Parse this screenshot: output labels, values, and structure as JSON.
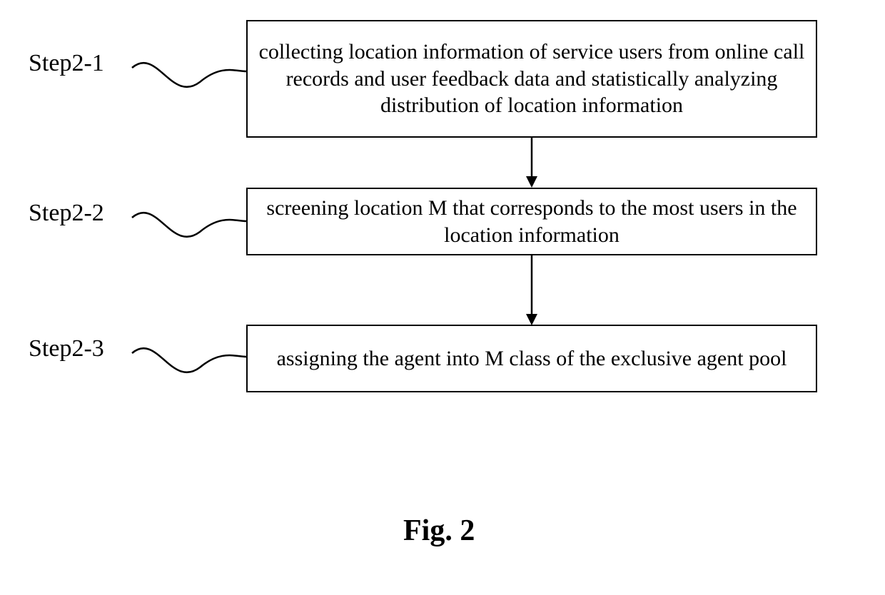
{
  "steps": [
    {
      "label": "Step2-1",
      "text": "collecting location information of service users from online call records and user feedback data and statistically analyzing distribution of location information"
    },
    {
      "label": "Step2-2",
      "text": "screening location M that corresponds to the most users in the location information"
    },
    {
      "label": "Step2-3",
      "text": "assigning the agent into M class of the exclusive agent pool"
    }
  ],
  "caption": "Fig. 2"
}
